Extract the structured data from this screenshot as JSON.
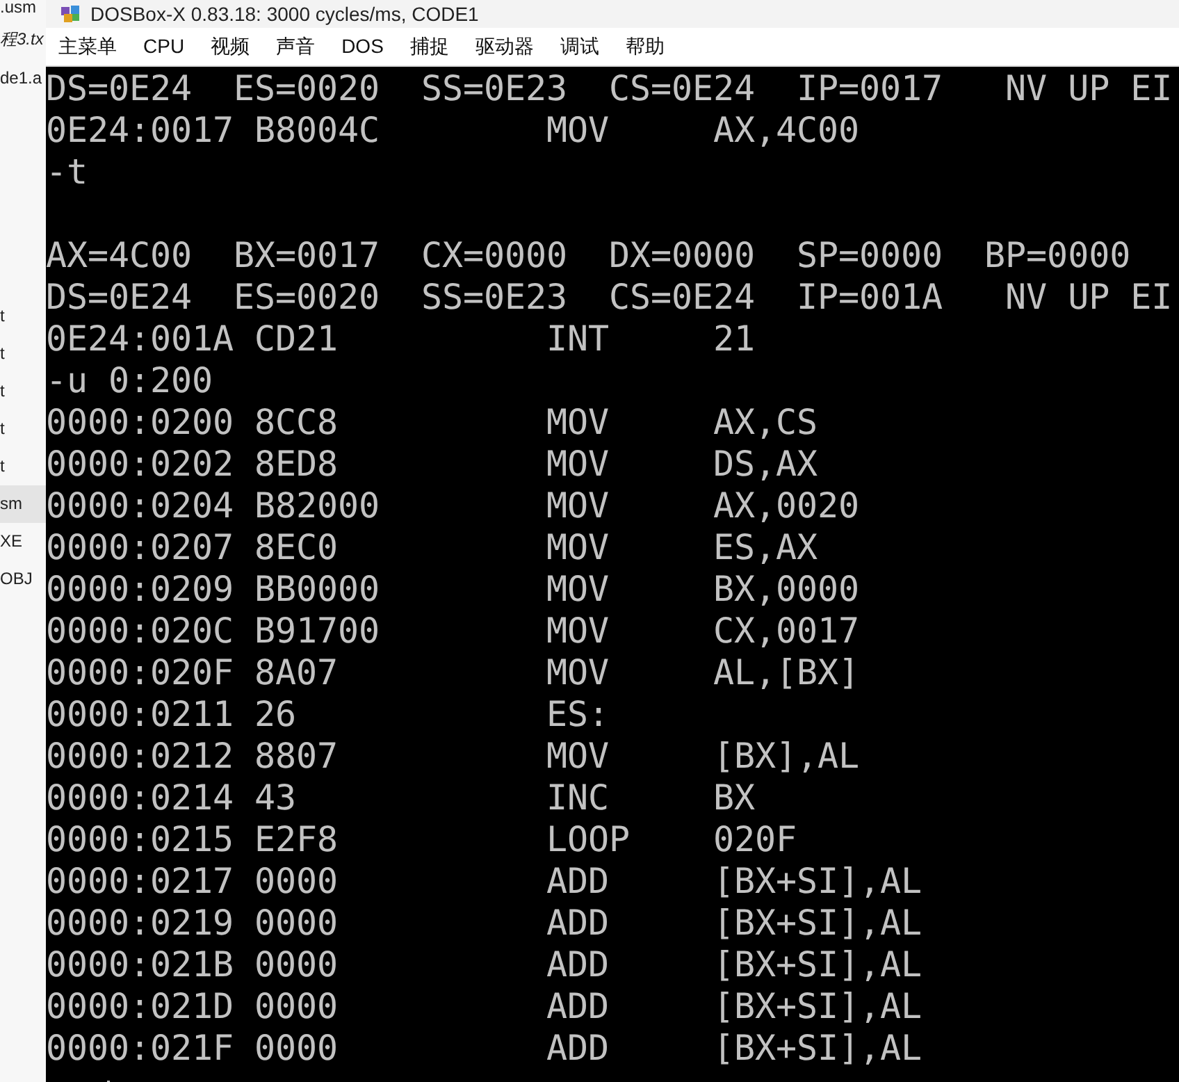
{
  "background_file_list": [
    {
      "label": ".usm",
      "selected": false
    },
    {
      "label": "程3.tx",
      "selected": false
    },
    {
      "label": "de1.a",
      "selected": false
    },
    {
      "label": "t",
      "selected": false
    },
    {
      "label": "t",
      "selected": false
    },
    {
      "label": "t",
      "selected": false
    },
    {
      "label": "t",
      "selected": false
    },
    {
      "label": "t",
      "selected": false
    },
    {
      "label": "sm",
      "selected": true
    },
    {
      "label": "XE",
      "selected": false
    },
    {
      "label": "OBJ",
      "selected": false
    }
  ],
  "window": {
    "title": "DOSBox-X 0.83.18: 3000 cycles/ms, CODE1"
  },
  "menu_bar": [
    "主菜单",
    "CPU",
    "视频",
    "声音",
    "DOS",
    "捕捉",
    "驱动器",
    "调试",
    "帮助"
  ],
  "console_blocks": [
    [
      "DS=0E24  ES=0020  SS=0E23  CS=0E24  IP=0017   NV UP EI",
      "0E24:0017 B8004C        MOV     AX,4C00",
      "-t"
    ],
    [
      "AX=4C00  BX=0017  CX=0000  DX=0000  SP=0000  BP=0000",
      "DS=0E24  ES=0020  SS=0E23  CS=0E24  IP=001A   NV UP EI",
      "0E24:001A CD21          INT     21",
      "-u 0:200",
      "0000:0200 8CC8          MOV     AX,CS",
      "0000:0202 8ED8          MOV     DS,AX",
      "0000:0204 B82000        MOV     AX,0020",
      "0000:0207 8EC0          MOV     ES,AX",
      "0000:0209 BB0000        MOV     BX,0000",
      "0000:020C B91700        MOV     CX,0017",
      "0000:020F 8A07          MOV     AL,[BX]",
      "0000:0211 26            ES:",
      "0000:0212 8807          MOV     [BX],AL",
      "0000:0214 43            INC     BX",
      "0000:0215 E2F8          LOOP    020F",
      "0000:0217 0000          ADD     [BX+SI],AL",
      "0000:0219 0000          ADD     [BX+SI],AL",
      "0000:021B 0000          ADD     [BX+SI],AL",
      "0000:021D 0000          ADD     [BX+SI],AL",
      "0000:021F 0000          ADD     [BX+SI],AL"
    ]
  ]
}
